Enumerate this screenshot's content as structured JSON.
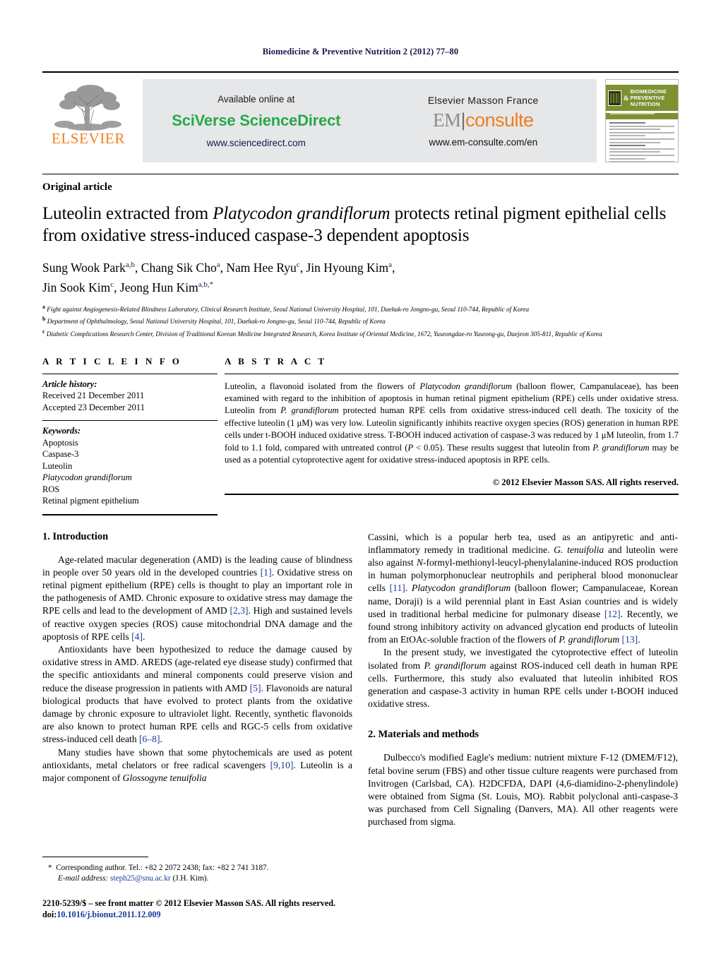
{
  "running_head": "Biomedicine & Preventive Nutrition 2 (2012) 77–80",
  "masthead": {
    "publisher_word": "ELSEVIER",
    "available_online": "Available online at",
    "sciverse": "SciVerse ScienceDirect",
    "sciencedirect_url": "www.sciencedirect.com",
    "elsevier_masson": "Elsevier Masson France",
    "em": "EM",
    "consulte": "consulte",
    "emconsulte_url": "www.em-consulte.com/en",
    "cover_title_line1": "BIOMEDICINE",
    "cover_title_line2": "PREVENTIVE NUTRITION",
    "cover_amp": "&"
  },
  "article": {
    "type": "Original article",
    "title_part1": "Luteolin extracted from ",
    "title_italic": "Platycodon grandiflorum",
    "title_part2": " protects retinal pigment epithelial cells from oxidative stress-induced caspase-3 dependent apoptosis",
    "authors_line1": "Sung Wook Park",
    "authors_line1_sup1": "a,b",
    "authors_line1_b": ", Chang Sik Cho",
    "authors_line1_sup2": "a",
    "authors_line1_c": ", Nam Hee Ryu",
    "authors_line1_sup3": "c",
    "authors_line1_d": ", Jin Hyoung Kim",
    "authors_line1_sup4": "a",
    "authors_line1_e": ",",
    "authors_line2": "Jin Sook Kim",
    "authors_line2_sup1": "c",
    "authors_line2_b": ", Jeong Hun Kim",
    "authors_line2_sup2": "a,b,*",
    "affiliations": [
      {
        "mark": "a",
        "text": "Fight against Angiogenesis-Related Blindness Laboratory, Clinical Research Institute, Seoul National University Hospital, 101, Daehak-ro Jongno-gu, Seoul 110-744, Republic of Korea"
      },
      {
        "mark": "b",
        "text": "Department of Ophthalmology, Seoul National University Hospital, 101, Daehak-ro Jongno-gu, Seoul 110-744, Republic of Korea"
      },
      {
        "mark": "c",
        "text": "Diabetic Complications Research Center, Division of Traditional Korean Medicine Integrated Research, Korea Institute of Oriental Medicine, 1672, Yuseongdae-ro Yuseong-gu, Daejeon 305-811, Republic of Korea"
      }
    ]
  },
  "article_info": {
    "heading": "A R T I C L E    I N F O",
    "history_label": "Article history:",
    "received": "Received 21 December 2011",
    "accepted": "Accepted 23 December 2011",
    "keywords_label": "Keywords:",
    "keywords": [
      "Apoptosis",
      "Caspase-3",
      "Luteolin",
      "Platycodon grandiflorum",
      "ROS",
      "Retinal pigment epithelium"
    ],
    "keyword_italic_index": 3
  },
  "abstract": {
    "heading": "A B S T R A C T",
    "p1_a": "Luteolin, a flavonoid isolated from the flowers of ",
    "p1_i1": "Platycodon grandiflorum",
    "p1_b": " (balloon flower, Campanulaceae), has been examined with regard to the inhibition of apoptosis in human retinal pigment epithelium (RPE) cells under oxidative stress. Luteolin from ",
    "p1_i2": "P. grandiflorum",
    "p1_c": " protected human RPE cells from oxidative stress-induced cell death. The toxicity of the effective luteolin (1 μM) was very low. Luteolin significantly inhibits reactive oxygen species (ROS) generation in human RPE cells under t-BOOH induced oxidative stress. T-BOOH induced activation of caspase-3 was reduced by 1 μM luteolin, from 1.7 fold to 1.1 fold, compared with untreated control (",
    "p1_i3": "P",
    "p1_d": " < 0.05). These results suggest that luteolin from ",
    "p1_i4": "P. grandiflorum",
    "p1_e": " may be used as a potential cytoprotective agent for oxidative stress-induced apoptosis in RPE cells.",
    "copyright": "© 2012 Elsevier Masson SAS. All rights reserved."
  },
  "sections": {
    "introduction_heading": "1.  Introduction",
    "methods_heading": "2.  Materials and methods",
    "intro_p1_a": "Age-related macular degeneration (AMD) is the leading cause of blindness in people over 50 years old in the developed countries ",
    "intro_p1_r1": "[1]",
    "intro_p1_b": ". Oxidative stress on retinal pigment epithelium (RPE) cells is thought to play an important role in the pathogenesis of AMD. Chronic exposure to oxidative stress may damage the RPE cells and lead to the development of AMD ",
    "intro_p1_r2": "[2,3]",
    "intro_p1_c": ". High and sustained levels of reactive oxygen species (ROS) cause mitochondrial DNA damage and the apoptosis of RPE cells ",
    "intro_p1_r3": "[4]",
    "intro_p1_d": ".",
    "intro_p2_a": "Antioxidants have been hypothesized to reduce the damage caused by oxidative stress in AMD. AREDS (age-related eye disease study) confirmed that the specific antioxidants and mineral components could preserve vision and reduce the disease progression in patients with AMD ",
    "intro_p2_r1": "[5]",
    "intro_p2_b": ". Flavonoids are natural biological products that have evolved to protect plants from the oxidative damage by chronic exposure to ultraviolet light. Recently, synthetic flavonoids are also known to protect human RPE cells and RGC-5 cells from oxidative stress-induced cell death ",
    "intro_p2_r2": "[6–8]",
    "intro_p2_c": ".",
    "intro_p3_a": "Many studies have shown that some phytochemicals are used as potent antioxidants, metal chelators or free radical scavengers ",
    "intro_p3_r1": "[9,10]",
    "intro_p3_b": ". Luteolin is a major component of ",
    "intro_p3_i1": "Glossogyne tenuifolia",
    "intro_p3_c": " Cassini, which is a popular herb tea, used as an antipyretic and anti-inflammatory remedy in traditional medicine. ",
    "intro_p3_i2": "G. tenuifolia",
    "intro_p3_d": " and luteolin were also against ",
    "intro_p3_i3": "N",
    "intro_p3_e": "-formyl-methionyl-leucyl-phenylalanine-induced ROS production in human polymorphonuclear neutrophils and peripheral blood mononuclear cells ",
    "intro_p3_r2": "[11]",
    "intro_p3_f": ". ",
    "intro_p3_i4": "Platycodon grandiflorum",
    "intro_p3_g": " (balloon flower; Campanulaceae, Korean name, Doraji) is a wild perennial plant in East Asian countries and is widely used in traditional herbal medicine for pulmonary disease ",
    "intro_p3_r3": "[12]",
    "intro_p3_h": ". Recently, we found strong inhibitory activity on advanced glycation end products of luteolin from an EtOAc-soluble fraction of the flowers of ",
    "intro_p3_i5": "P. grandiflorum",
    "intro_p3_i": " ",
    "intro_p3_r4": "[13]",
    "intro_p3_j": ".",
    "intro_p4_a": "In the present study, we investigated the cytoprotective effect of luteolin isolated from ",
    "intro_p4_i1": "P. grandiflorum",
    "intro_p4_b": " against ROS-induced cell death in human RPE cells. Furthermore, this study also evaluated that luteolin inhibited ROS generation and caspase-3 activity in human RPE cells under t-BOOH induced oxidative stress.",
    "methods_p1": "Dulbecco's modified Eagle's medium: nutrient mixture F-12 (DMEM/F12), fetal bovine serum (FBS) and other tissue culture reagents were purchased from Invitrogen (Carlsbad, CA). H2DCFDA, DAPI (4,6-diamidino-2-phenylindole) were obtained from Sigma (St. Louis, MO). Rabbit polyclonal anti-caspase-3 was purchased from Cell Signaling (Danvers, MA). All other reagents were purchased from sigma."
  },
  "footnotes": {
    "corresponding_mark": "*",
    "corresponding": "Corresponding author. Tel.: +82 2 2072 2438; fax: +82 2 741 3187.",
    "email_label": "E-mail address:",
    "email": "steph25@snu.ac.kr",
    "email_suffix": "(J.H. Kim).",
    "front_matter": "2210-5239/$ – see front matter © 2012 Elsevier Masson SAS. All rights reserved.",
    "doi_label": "doi:",
    "doi": "10.1016/j.bionut.2011.12.009"
  },
  "colors": {
    "link": "#1a3a9e",
    "elsevier_orange": "#f28022",
    "sciencedirect_green": "#2aa84a",
    "consulte_orange": "#f07d1c",
    "cover_green": "#7d9133",
    "running_head": "#17174a"
  }
}
